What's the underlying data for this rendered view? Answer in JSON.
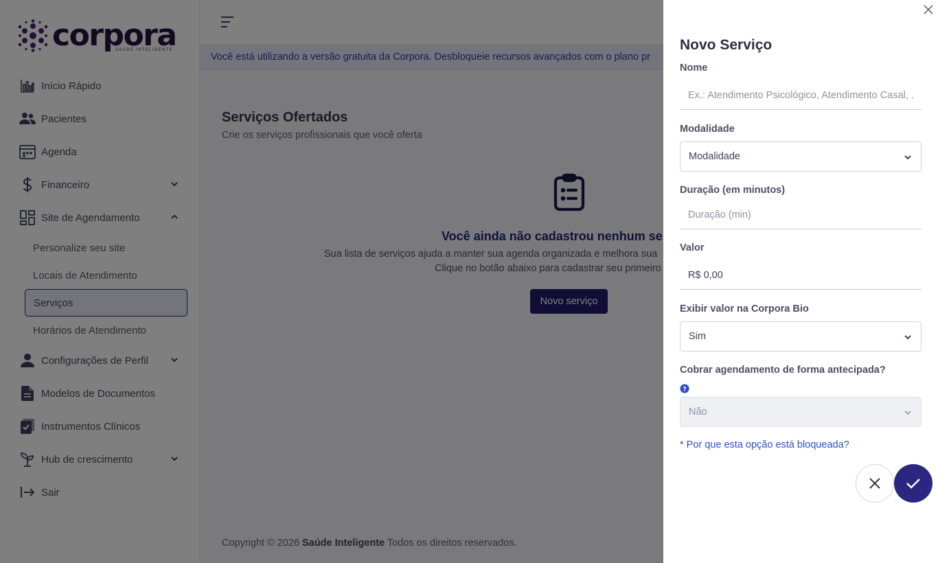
{
  "brand": {
    "name": "corpora",
    "tagline": "SAÚDE INTELIGENTE"
  },
  "sidebar": {
    "items": [
      {
        "label": "Início Rápido",
        "icon": "bar-chart-icon"
      },
      {
        "label": "Pacientes",
        "icon": "people-icon"
      },
      {
        "label": "Agenda",
        "icon": "calendar-icon"
      },
      {
        "label": "Financeiro",
        "icon": "dollar-icon",
        "expanded": false
      },
      {
        "label": "Site de Agendamento",
        "icon": "dashboard-icon",
        "expanded": true,
        "children": [
          "Personalize seu site",
          "Locais de Atendimento",
          "Serviços",
          "Horários de Atendimento"
        ],
        "active_child": "Serviços"
      },
      {
        "label": "Configurações de Perfil",
        "icon": "person-icon",
        "expanded": false
      },
      {
        "label": "Modelos de Documentos",
        "icon": "document-icon"
      },
      {
        "label": "Instrumentos Clínicos",
        "icon": "clipboard-check-icon"
      },
      {
        "label": "Hub de crescimento",
        "icon": "sprout-icon",
        "expanded": false
      },
      {
        "label": "Sair",
        "icon": "logout-icon"
      }
    ]
  },
  "banner": {
    "text": "Você está utilizando a versão gratuita da Corpora. Desbloqueie recursos avançados com o plano pr"
  },
  "main": {
    "title": "Serviços Ofertados",
    "subtitle": "Crie os serviços profissionais que você oferta",
    "empty": {
      "title": "Você ainda não cadastrou nenhum se",
      "line1": "Sua lista de serviços ajuda a manter sua agenda organizada e melhora sua",
      "line2": "Clique no botão abaixo para cadastrar seu primeiro",
      "button": "Novo serviço"
    },
    "footer": {
      "prefix": "Copyright © 2026",
      "company": "Saúde Inteligente",
      "suffix": "Todos os direitos reservados."
    }
  },
  "drawer": {
    "title": "Novo Serviço",
    "fields": {
      "nome": {
        "label": "Nome",
        "placeholder": "Ex.: Atendimento Psicológico, Atendimento Casal, ...",
        "value": ""
      },
      "modalidade": {
        "label": "Modalidade",
        "value": "Modalidade"
      },
      "duracao": {
        "label": "Duração (em minutos)",
        "placeholder": "Duração (min)",
        "value": ""
      },
      "valor": {
        "label": "Valor",
        "value": "R$ 0,00"
      },
      "exibir": {
        "label": "Exibir valor na Corpora Bio",
        "value": "Sim"
      },
      "cobrar": {
        "label": "Cobrar agendamento de forma antecipada?",
        "value": "Não",
        "disabled": true
      }
    },
    "blocked_link": "* Por que esta opção está bloqueada?"
  },
  "colors": {
    "primary": "#2b2780",
    "brand": "#2a1042",
    "link": "#2b50c8"
  }
}
